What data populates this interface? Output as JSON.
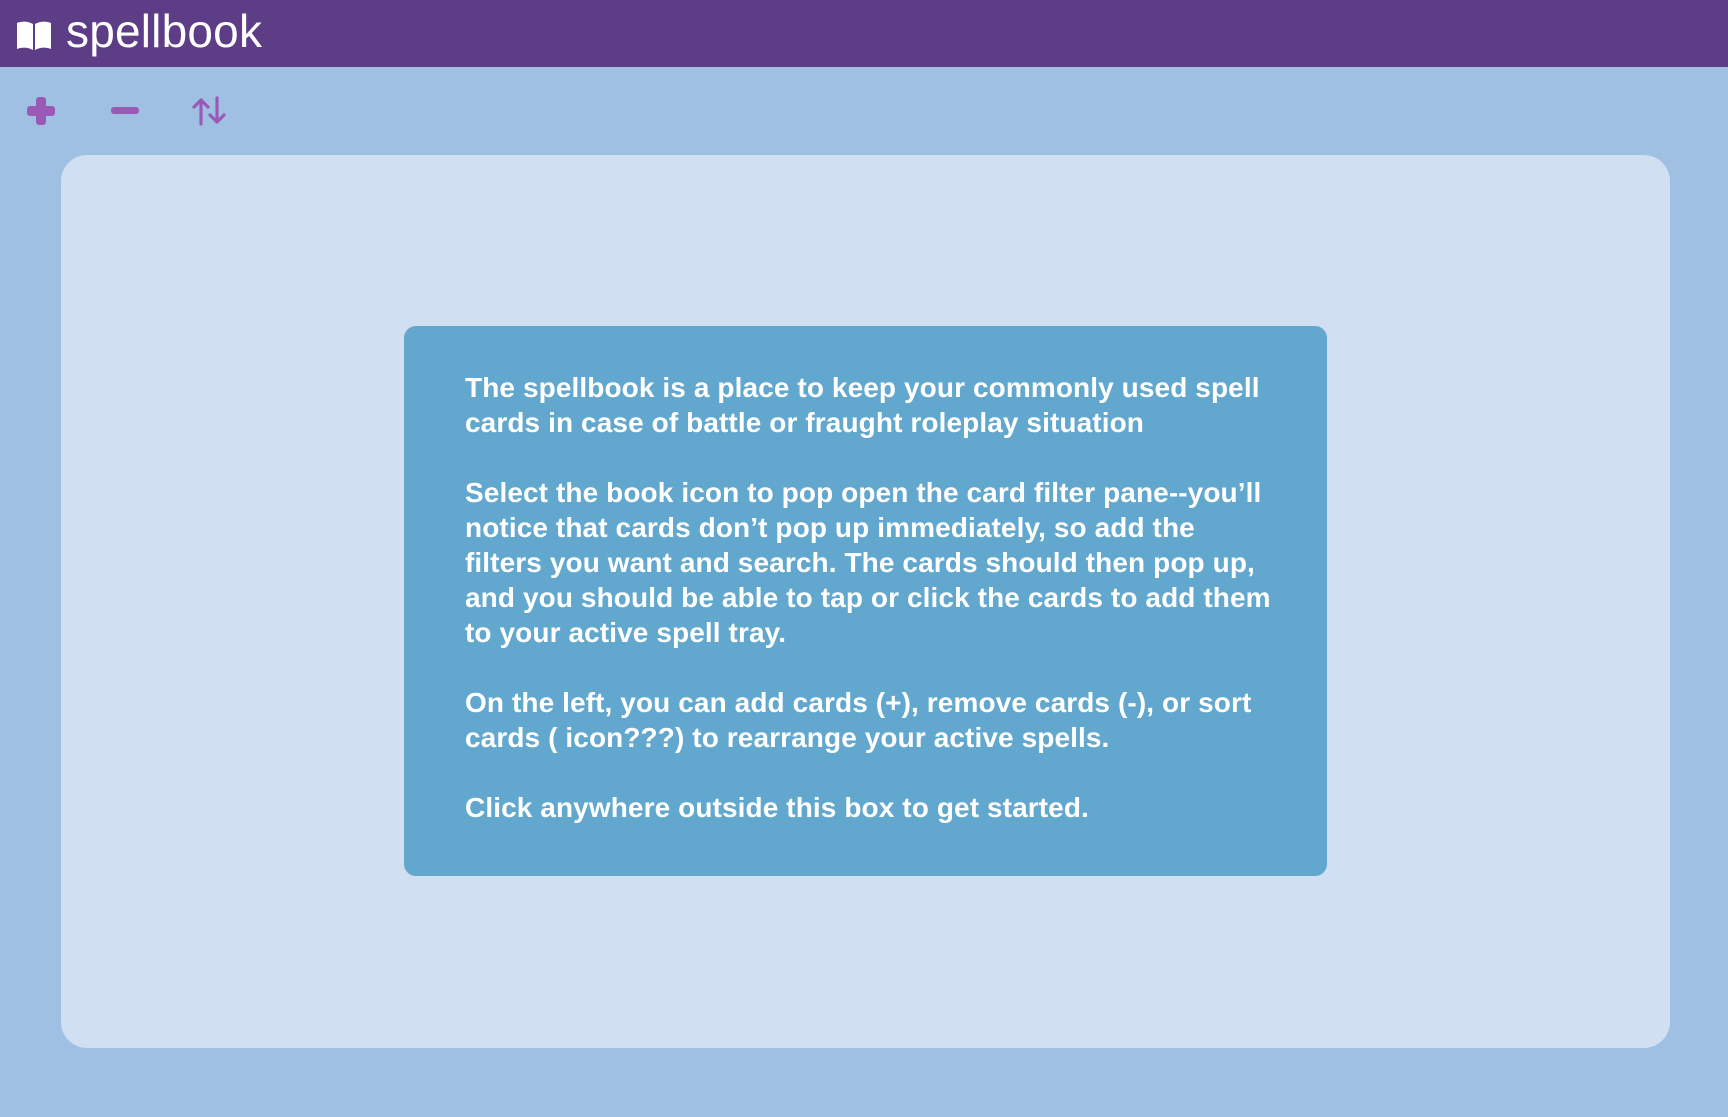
{
  "header": {
    "title": "spellbook",
    "icon": "book-open-icon",
    "background": "#5e3d87"
  },
  "toolbar": {
    "add_icon": "plus-icon",
    "remove_icon": "minus-icon",
    "sort_icon": "sort-arrows-icon",
    "icon_color": "#9b59b6"
  },
  "help": {
    "paragraphs": [
      "The spellbook is a place to keep your commonly used spell cards in case of battle or fraught roleplay situation",
      "Select the book icon to pop open the card filter pane--you’ll notice that cards don’t pop up immediately, so add the filters you want and search. The cards should then pop up, and you should be able to tap or click the cards to add them to your active spell tray.",
      "On the left, you can add cards (+), remove cards (-), or sort cards ( icon???) to rearrange your active spells.",
      "Click anywhere outside this box to get started."
    ],
    "background": "#62a7cd"
  },
  "colors": {
    "page_background": "#9fc0e3",
    "tray_background": "#d0dff1"
  }
}
